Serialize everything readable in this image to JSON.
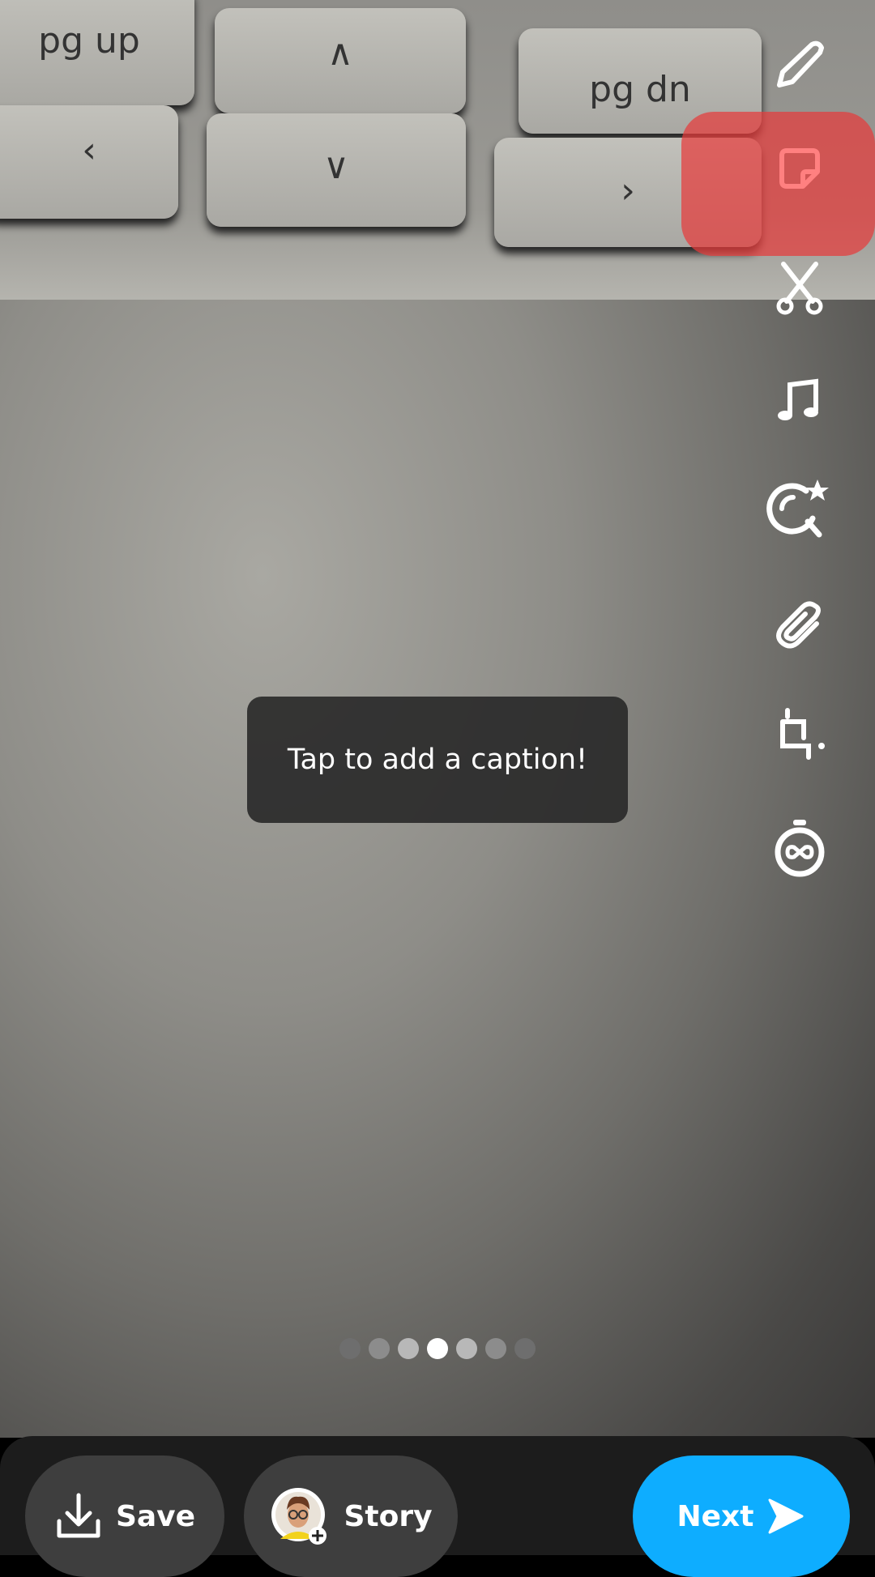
{
  "photo": {
    "keys": [
      "pg up",
      "pg dn"
    ]
  },
  "toolbar": {
    "items": [
      {
        "name": "pencil-icon",
        "label": "Draw"
      },
      {
        "name": "sticker-icon",
        "label": "Stickers",
        "highlighted": true
      },
      {
        "name": "scissors-icon",
        "label": "Scissors"
      },
      {
        "name": "music-note-icon",
        "label": "Music"
      },
      {
        "name": "lens-search-star-icon",
        "label": "Lenses"
      },
      {
        "name": "paperclip-icon",
        "label": "Link"
      },
      {
        "name": "crop-icon",
        "label": "Crop"
      },
      {
        "name": "timer-infinity-icon",
        "label": "Timer"
      }
    ],
    "highlight_color": "#e63c3c"
  },
  "caption": {
    "placeholder": "Tap to add a caption!"
  },
  "pager": {
    "count": 7,
    "active_index": 3
  },
  "bottom": {
    "save_label": "Save",
    "story_label": "Story",
    "next_label": "Next",
    "next_color": "#0eadff"
  }
}
